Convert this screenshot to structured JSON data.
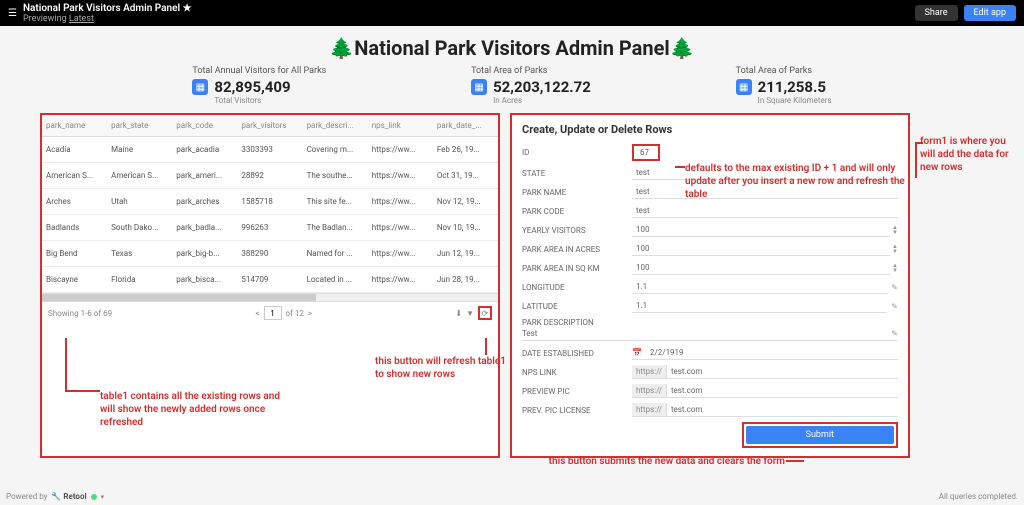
{
  "topbar": {
    "title": "National Park Visitors Admin Panel",
    "sub_prefix": "Previewing",
    "sub_link": "Latest",
    "share": "Share",
    "edit": "Edit app"
  },
  "page_title": "🌲National Park Visitors Admin Panel🌲",
  "metrics": [
    {
      "label": "Total Annual Visitors for All Parks",
      "value": "82,895,409",
      "sub": "Total Visitors"
    },
    {
      "label": "Total Area of Parks",
      "value": "52,203,122.72",
      "sub": "In Acres"
    },
    {
      "label": "Total Area of Parks",
      "value": "211,258.5",
      "sub": "In Square Kilometers"
    }
  ],
  "table": {
    "headers": [
      "park_name",
      "park_state",
      "park_code",
      "park_visitors",
      "park_descri...",
      "nps_link",
      "park_date_..."
    ],
    "rows": [
      [
        "Acadia",
        "Maine",
        "park_acadia",
        "3303393",
        "Covering m...",
        "https://ww...",
        "Feb 26, 19..."
      ],
      [
        "American S...",
        "American S...",
        "park_ameri...",
        "28892",
        "The southe...",
        "https://ww...",
        "Oct 31, 19..."
      ],
      [
        "Arches",
        "Utah",
        "park_arches",
        "1585718",
        "This site fe...",
        "https://ww...",
        "Nov 12, 19..."
      ],
      [
        "Badlands",
        "South Dako...",
        "park_badla...",
        "996263",
        "The Badlan...",
        "https://ww...",
        "Nov 10, 19..."
      ],
      [
        "Big Bend",
        "Texas",
        "park_big-b...",
        "388290",
        "Named for ...",
        "https://ww...",
        "Jun 12, 19..."
      ],
      [
        "Biscayne",
        "Florida",
        "park_bisca...",
        "514709",
        "Located in ...",
        "https://ww...",
        "Jun 28, 19..."
      ]
    ],
    "footer_text": "Showing 1-6 of 69",
    "page": "1",
    "total_pages": "of 12"
  },
  "form": {
    "title": "Create, Update or Delete Rows",
    "fields": {
      "id": {
        "label": "ID",
        "value": "67"
      },
      "state": {
        "label": "STATE",
        "value": "test"
      },
      "park_name": {
        "label": "PARK NAME",
        "value": "test"
      },
      "park_code": {
        "label": "PARK CODE",
        "value": "test"
      },
      "yearly": {
        "label": "YEARLY VISITORS",
        "value": "100"
      },
      "acres": {
        "label": "PARK AREA IN ACRES",
        "value": "100"
      },
      "sqkm": {
        "label": "PARK AREA IN SQ KM",
        "value": "100"
      },
      "lon": {
        "label": "LONGITUDE",
        "value": "1.1"
      },
      "lat": {
        "label": "LATITUDE",
        "value": "1.1"
      },
      "desc": {
        "label": "PARK DESCRIPTION",
        "value": "Test"
      },
      "date": {
        "label": "DATE ESTABLISHED",
        "value": "2/2/1919"
      },
      "nps": {
        "label": "NPS LINK",
        "prefix": "https://",
        "value": "test.com"
      },
      "preview": {
        "label": "PREVIEW PIC",
        "prefix": "https://",
        "value": "test.com"
      },
      "license": {
        "label": "PREV. PIC LICENSE",
        "prefix": "https://",
        "value": "test.com"
      }
    },
    "submit": "Submit"
  },
  "annotations": {
    "table1": "table1 contains all the existing rows and will show the newly added rows once refreshed",
    "refresh": "this button will refresh table1 to show new rows",
    "form1": "form1 is where you will add the data for new rows",
    "id_default": "defaults to the max existing ID + 1 and will only update after you insert a new row and refresh the table",
    "submit_note": "this button submits the new data and clears the form"
  },
  "footer": {
    "powered": "Powered by",
    "brand": "Retool",
    "queries": "All queries completed."
  }
}
